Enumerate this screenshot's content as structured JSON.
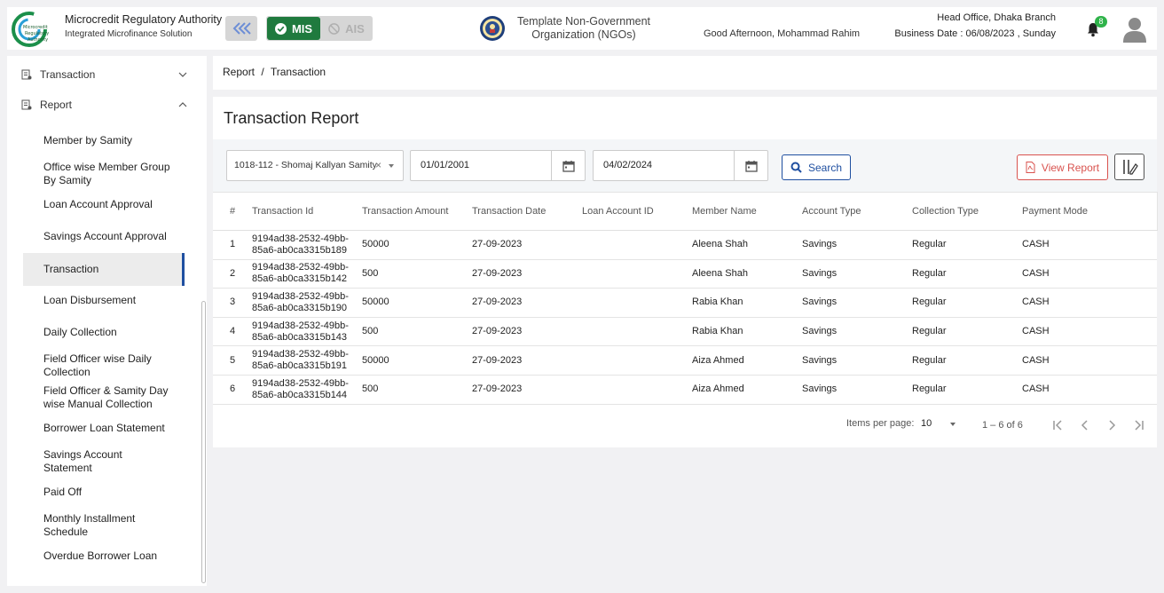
{
  "header": {
    "org_name": "Microcredit Regulatory Authority",
    "org_sub": "Integrated Microfinance Solution",
    "mis_label": "MIS",
    "ais_label": "AIS",
    "ngo_line1": "Template Non-Government",
    "ngo_line2": "Organization (NGOs)",
    "greeting": "Good Afternoon, Mohammad Rahim",
    "branch": "Head Office, Dhaka Branch",
    "business_date": "Business Date : 06/08/2023 , Sunday",
    "notification_count": "8"
  },
  "sidebar": {
    "top_items": [
      {
        "label": "Transaction"
      },
      {
        "label": "Report"
      }
    ],
    "items": [
      {
        "label": "Member by Samity"
      },
      {
        "label": "Office wise Member Group By Samity"
      },
      {
        "label": "Loan Account Approval"
      },
      {
        "label": "Savings Account Approval"
      },
      {
        "label": "Transaction"
      },
      {
        "label": "Loan Disbursement"
      },
      {
        "label": "Daily Collection"
      },
      {
        "label": "Field Officer wise Daily Collection"
      },
      {
        "label": "Field Officer & Samity Day wise Manual Collection"
      },
      {
        "label": "Borrower Loan Statement"
      },
      {
        "label": "Savings Account Statement"
      },
      {
        "label": "Paid Off"
      },
      {
        "label": "Monthly Installment Schedule"
      },
      {
        "label": "Overdue Borrower Loan"
      }
    ],
    "active_item": "Transaction"
  },
  "breadcrumb": {
    "parent": "Report",
    "separator": "/",
    "current": "Transaction"
  },
  "page": {
    "title": "Transaction Report"
  },
  "filters": {
    "samity": "1018-112 - Shomaj Kallyan Samity",
    "from_date": "01/01/2001",
    "to_date": "04/02/2024",
    "search_label": "Search",
    "view_report_label": "View Report"
  },
  "table": {
    "columns": [
      "#",
      "Transaction Id",
      "Transaction Amount",
      "Transaction Date",
      "Loan Account ID",
      "Member Name",
      "Account Type",
      "Collection Type",
      "Payment Mode"
    ],
    "rows": [
      {
        "no": "1",
        "txn_id_1": "9194ad38-2532-49bb-",
        "txn_id_2": "85a6-ab0ca3315b189",
        "amount": "50000",
        "date": "27-09-2023",
        "loan_account": "",
        "member": "Aleena Shah",
        "account_type": "Savings",
        "collection_type": "Regular",
        "payment_mode": "CASH"
      },
      {
        "no": "2",
        "txn_id_1": "9194ad38-2532-49bb-",
        "txn_id_2": "85a6-ab0ca3315b142",
        "amount": "500",
        "date": "27-09-2023",
        "loan_account": "",
        "member": "Aleena Shah",
        "account_type": "Savings",
        "collection_type": "Regular",
        "payment_mode": "CASH"
      },
      {
        "no": "3",
        "txn_id_1": "9194ad38-2532-49bb-",
        "txn_id_2": "85a6-ab0ca3315b190",
        "amount": "50000",
        "date": "27-09-2023",
        "loan_account": "",
        "member": "Rabia Khan",
        "account_type": "Savings",
        "collection_type": "Regular",
        "payment_mode": "CASH"
      },
      {
        "no": "4",
        "txn_id_1": "9194ad38-2532-49bb-",
        "txn_id_2": "85a6-ab0ca3315b143",
        "amount": "500",
        "date": "27-09-2023",
        "loan_account": "",
        "member": "Rabia Khan",
        "account_type": "Savings",
        "collection_type": "Regular",
        "payment_mode": "CASH"
      },
      {
        "no": "5",
        "txn_id_1": "9194ad38-2532-49bb-",
        "txn_id_2": "85a6-ab0ca3315b191",
        "amount": "50000",
        "date": "27-09-2023",
        "loan_account": "",
        "member": "Aiza Ahmed",
        "account_type": "Savings",
        "collection_type": "Regular",
        "payment_mode": "CASH"
      },
      {
        "no": "6",
        "txn_id_1": "9194ad38-2532-49bb-",
        "txn_id_2": "85a6-ab0ca3315b144",
        "amount": "500",
        "date": "27-09-2023",
        "loan_account": "",
        "member": "Aiza Ahmed",
        "account_type": "Savings",
        "collection_type": "Regular",
        "payment_mode": "CASH"
      }
    ]
  },
  "paginator": {
    "items_per_page_label": "Items per page:",
    "page_size": "10",
    "range": "1 – 6 of 6"
  },
  "icons": {
    "collapse": "double-chevron-left-icon",
    "mis": "check-circle-icon",
    "ais": "block-icon",
    "calendar": "calendar-icon",
    "search": "search-icon",
    "pdf": "pdf-file-icon",
    "columns": "column-settings-icon",
    "bell": "bell-icon",
    "avatar": "user-avatar-icon"
  },
  "colors": {
    "primary_blue": "#1f4fa0",
    "mis_green": "#1f7a3e",
    "badge_green": "#2fb34a",
    "report_red": "#d9534f"
  }
}
